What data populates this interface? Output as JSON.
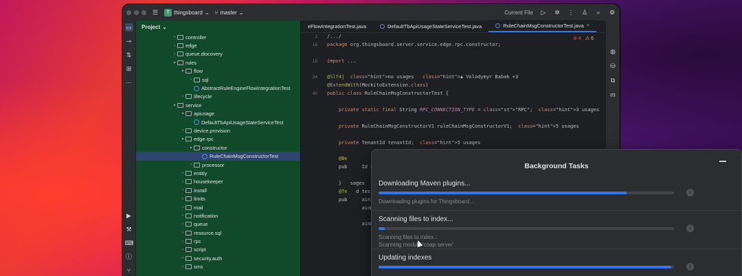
{
  "titlebar": {
    "project_badge": "T",
    "project_name": "thingsboard",
    "branch": "master",
    "run_config": "Current File"
  },
  "project_panel": {
    "title": "Project",
    "rows": [
      {
        "label": "controller",
        "indent": 4,
        "type": "folder",
        "expanded": false
      },
      {
        "label": "edge",
        "indent": 4,
        "type": "folder",
        "expanded": false
      },
      {
        "label": "queue.discovery",
        "indent": 4,
        "type": "folder",
        "expanded": false
      },
      {
        "label": "rules",
        "indent": 4,
        "type": "folder",
        "expanded": true
      },
      {
        "label": "flow",
        "indent": 5,
        "type": "folder",
        "expanded": true
      },
      {
        "label": "sql",
        "indent": 6,
        "type": "folder",
        "expanded": false
      },
      {
        "label": "AbstractRuleEngineFlowIntegrationTest",
        "indent": 6,
        "type": "class"
      },
      {
        "label": "lifecycle",
        "indent": 5,
        "type": "folder",
        "expanded": false
      },
      {
        "label": "service",
        "indent": 4,
        "type": "folder",
        "expanded": true
      },
      {
        "label": "apiusage",
        "indent": 5,
        "type": "folder",
        "expanded": true
      },
      {
        "label": "DefaultTbApiUsageStateServiceTest",
        "indent": 6,
        "type": "class"
      },
      {
        "label": "device.provision",
        "indent": 5,
        "type": "folder",
        "expanded": false
      },
      {
        "label": "edge.rpc",
        "indent": 5,
        "type": "folder",
        "expanded": true
      },
      {
        "label": "constructor",
        "indent": 6,
        "type": "folder",
        "expanded": true
      },
      {
        "label": "RuleChainMsgConstructorTest",
        "indent": 7,
        "type": "class",
        "selected": true
      },
      {
        "label": "processor",
        "indent": 6,
        "type": "folder",
        "expanded": false
      },
      {
        "label": "entitiy",
        "indent": 5,
        "type": "folder",
        "expanded": false
      },
      {
        "label": "housekeeper",
        "indent": 5,
        "type": "folder",
        "expanded": false
      },
      {
        "label": "install",
        "indent": 5,
        "type": "folder",
        "expanded": false
      },
      {
        "label": "limits",
        "indent": 5,
        "type": "folder",
        "expanded": false
      },
      {
        "label": "mail",
        "indent": 5,
        "type": "folder",
        "expanded": false
      },
      {
        "label": "notification",
        "indent": 5,
        "type": "folder",
        "expanded": false
      },
      {
        "label": "queue",
        "indent": 5,
        "type": "folder",
        "expanded": false
      },
      {
        "label": "resource.sql",
        "indent": 5,
        "type": "folder",
        "expanded": false
      },
      {
        "label": "rpc",
        "indent": 5,
        "type": "folder",
        "expanded": false
      },
      {
        "label": "script",
        "indent": 5,
        "type": "folder",
        "expanded": false
      },
      {
        "label": "security.auth",
        "indent": 5,
        "type": "folder",
        "expanded": false
      },
      {
        "label": "sms",
        "indent": 5,
        "type": "folder",
        "expanded": false
      }
    ]
  },
  "editor": {
    "tabs": [
      {
        "label": "eFlowIntegrationTest.java",
        "active": false
      },
      {
        "label": "DefaultTbApiUsageStateServiceTest.java",
        "active": false
      },
      {
        "label": "RuleChainMsgConstructorTest.java",
        "active": true
      }
    ],
    "inspections": {
      "errors": "4",
      "warnings": "6"
    },
    "line_numbers": [
      "1",
      "16",
      "",
      "18",
      "",
      "34",
      "",
      "40",
      "",
      "",
      "",
      "",
      "",
      "",
      "",
      "",
      "",
      "",
      "",
      "",
      "",
      "",
      "",
      "",
      "",
      "",
      "",
      "",
      "",
      "",
      ""
    ],
    "code_lines": [
      "/.../",
      "package org.thingsboard.server.service.edge.rpc.constructor;",
      "",
      "import ...",
      "",
      "@Slf4j  no usages   ♟ Volodymyr Babak +3",
      "@ExtendWith(MockitoExtension.class)",
      "public class RuleChainMsgConstructorTest {",
      "",
      "    private static final String RPC_CONNECTION_TYPE = \"RPC\";  3 usages",
      "",
      "    private RuleChainMsgConstructorV1 ruleChainMsgConstructorV1;  5 usages",
      "",
      "    private TenantId tenantId;  5 usages",
      "",
      "    @Be",
      "    pub     Id = new TenantId(UUID.randomUUID());",
      "",
      "    }   sages",
      "    @Te   d test",
      "    pub     ainId",
      "            ainMet",
      "               rule",
      "            ainMet",
      "               rule"
    ]
  },
  "background_tasks": {
    "title": "Background Tasks",
    "tasks": [
      {
        "name": "Downloading Maven plugins...",
        "progress": 0.84,
        "detail": "Downloading plugins for Thingsboard...",
        "detail2": ""
      },
      {
        "name": "Scanning files to index...",
        "progress": 0.02,
        "detail": "Scanning files to index...",
        "detail2": "Scanning module 'coap-server'"
      },
      {
        "name": "Updating indexes",
        "progress": 0.99,
        "detail": "",
        "detail2": ""
      }
    ]
  }
}
